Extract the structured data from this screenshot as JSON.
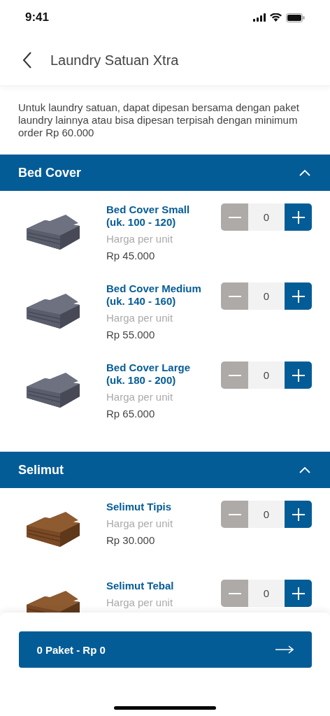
{
  "status_bar": {
    "time": "9:41"
  },
  "header": {
    "title": "Laundry Satuan Xtra"
  },
  "description": "Untuk laundry satuan, dapat dipesan bersama dengan paket laundry lainnya atau bisa dipesan terpisah dengan minimum order Rp 60.000",
  "sections": [
    {
      "title": "Bed Cover",
      "expanded": true,
      "items": [
        {
          "name": "Bed Cover Small (uk. 100 - 120)",
          "price_label": "Harga per unit",
          "price": "Rp 45.000",
          "quantity": "0",
          "decrease_disabled": true
        },
        {
          "name": "Bed Cover Medium (uk. 140 - 160)",
          "price_label": "Harga per unit",
          "price": "Rp 55.000",
          "quantity": "0",
          "decrease_disabled": true
        },
        {
          "name": "Bed Cover Large (uk. 180 - 200)",
          "price_label": "Harga per unit",
          "price": "Rp 65.000",
          "quantity": "0",
          "decrease_disabled": true
        }
      ]
    },
    {
      "title": "Selimut",
      "expanded": true,
      "items": [
        {
          "name": "Selimut Tipis",
          "price_label": "Harga per unit",
          "price": "Rp 30.000",
          "quantity": "0",
          "decrease_disabled": true
        },
        {
          "name": "Selimut Tebal",
          "price_label": "Harga per unit",
          "quantity": "0",
          "decrease_disabled": true
        }
      ]
    }
  ],
  "footer": {
    "button": "0 Paket - Rp 0"
  }
}
